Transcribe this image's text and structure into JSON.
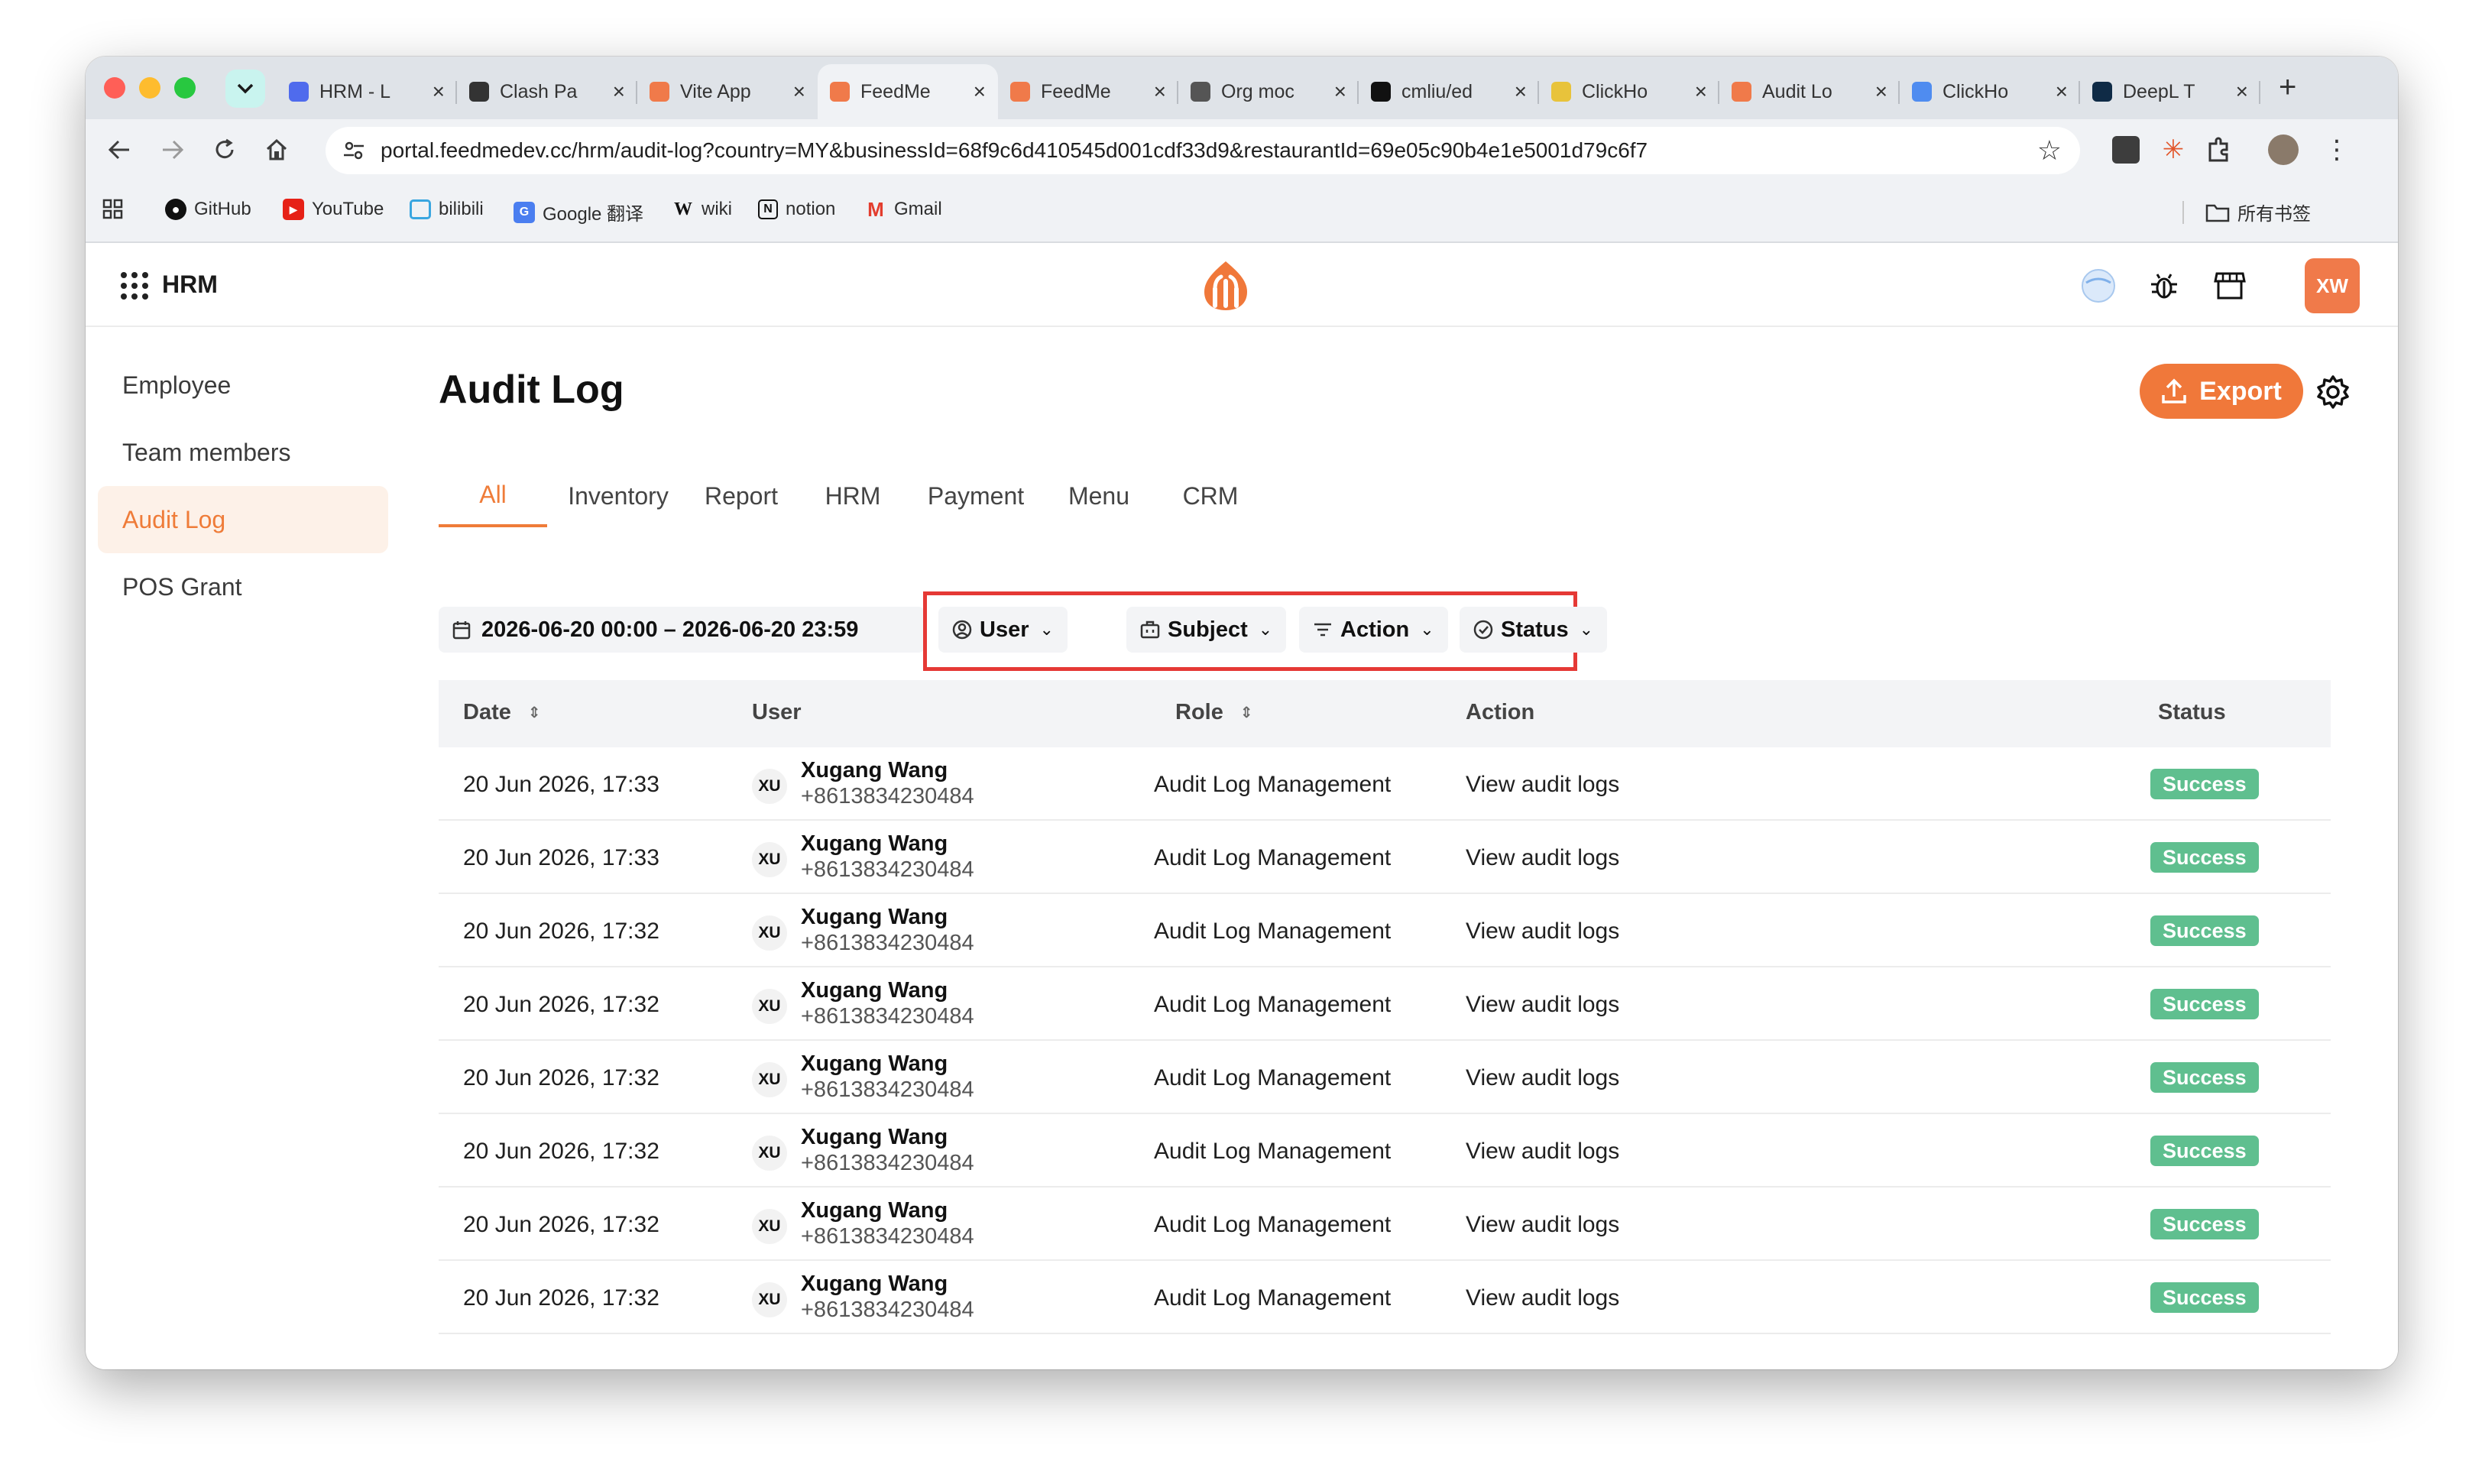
{
  "browser": {
    "tabs": [
      {
        "title": "HRM - L",
        "favicon_color": "#4f6bed",
        "active": false
      },
      {
        "title": "Clash Pa",
        "favicon_color": "#333333",
        "active": false
      },
      {
        "title": "Vite App",
        "favicon_color": "#f07a4a",
        "active": false
      },
      {
        "title": "FeedMe",
        "favicon_color": "#f07a4a",
        "active": true
      },
      {
        "title": "FeedMe",
        "favicon_color": "#f07a4a",
        "active": false
      },
      {
        "title": "Org moc",
        "favicon_color": "#555555",
        "active": false
      },
      {
        "title": "cmliu/ed",
        "favicon_color": "#111111",
        "active": false
      },
      {
        "title": "ClickHo",
        "favicon_color": "#e8c33b",
        "active": false
      },
      {
        "title": "Audit Lo",
        "favicon_color": "#f07a4a",
        "active": false
      },
      {
        "title": "ClickHo",
        "favicon_color": "#4f8cf0",
        "active": false
      },
      {
        "title": "DeepL T",
        "favicon_color": "#0f2b46",
        "active": false
      }
    ],
    "url": "portal.feedmedev.cc/hrm/audit-log?country=MY&businessId=68f9c6d410545d001cdf33d9&restaurantId=69e05c90b4e1e5001d79c6f7",
    "bookmarks": [
      {
        "label": "GitHub",
        "icon": "github-icon"
      },
      {
        "label": "YouTube",
        "icon": "youtube-icon"
      },
      {
        "label": "bilibili",
        "icon": "bilibili-icon"
      },
      {
        "label": "Google 翻译",
        "icon": "google-translate-icon"
      },
      {
        "label": "wiki",
        "icon": "wikipedia-icon"
      },
      {
        "label": "notion",
        "icon": "notion-icon"
      },
      {
        "label": "Gmail",
        "icon": "gmail-icon"
      }
    ],
    "all_bookmarks_label": "所有书签"
  },
  "app": {
    "name": "HRM",
    "avatar_initials": "XW",
    "brand_color": "#f0783a"
  },
  "sidebar": {
    "items": [
      {
        "label": "Employee",
        "active": false
      },
      {
        "label": "Team members",
        "active": false
      },
      {
        "label": "Audit Log",
        "active": true
      },
      {
        "label": "POS Grant",
        "active": false
      }
    ]
  },
  "main": {
    "title": "Audit Log",
    "export_label": "Export",
    "category_tabs": [
      "All",
      "Inventory",
      "Report",
      "HRM",
      "Payment",
      "Menu",
      "CRM"
    ],
    "active_tab": "All",
    "date_range": "2026-06-20 00:00 – 2026-06-20 23:59",
    "filters": {
      "user": "User",
      "subject": "Subject",
      "action": "Action",
      "status": "Status"
    },
    "table": {
      "columns": {
        "date": "Date",
        "user": "User",
        "role": "Role",
        "action": "Action",
        "status": "Status"
      },
      "rows": [
        {
          "date": "20 Jun 2026, 17:33",
          "initials": "XU",
          "name": "Xugang Wang",
          "phone": "+8613834230484",
          "role": "Audit Log Management",
          "action": "View audit logs",
          "status": "Success"
        },
        {
          "date": "20 Jun 2026, 17:33",
          "initials": "XU",
          "name": "Xugang Wang",
          "phone": "+8613834230484",
          "role": "Audit Log Management",
          "action": "View audit logs",
          "status": "Success"
        },
        {
          "date": "20 Jun 2026, 17:32",
          "initials": "XU",
          "name": "Xugang Wang",
          "phone": "+8613834230484",
          "role": "Audit Log Management",
          "action": "View audit logs",
          "status": "Success"
        },
        {
          "date": "20 Jun 2026, 17:32",
          "initials": "XU",
          "name": "Xugang Wang",
          "phone": "+8613834230484",
          "role": "Audit Log Management",
          "action": "View audit logs",
          "status": "Success"
        },
        {
          "date": "20 Jun 2026, 17:32",
          "initials": "XU",
          "name": "Xugang Wang",
          "phone": "+8613834230484",
          "role": "Audit Log Management",
          "action": "View audit logs",
          "status": "Success"
        },
        {
          "date": "20 Jun 2026, 17:32",
          "initials": "XU",
          "name": "Xugang Wang",
          "phone": "+8613834230484",
          "role": "Audit Log Management",
          "action": "View audit logs",
          "status": "Success"
        },
        {
          "date": "20 Jun 2026, 17:32",
          "initials": "XU",
          "name": "Xugang Wang",
          "phone": "+8613834230484",
          "role": "Audit Log Management",
          "action": "View audit logs",
          "status": "Success"
        },
        {
          "date": "20 Jun 2026, 17:32",
          "initials": "XU",
          "name": "Xugang Wang",
          "phone": "+8613834230484",
          "role": "Audit Log Management",
          "action": "View audit logs",
          "status": "Success"
        }
      ]
    }
  }
}
